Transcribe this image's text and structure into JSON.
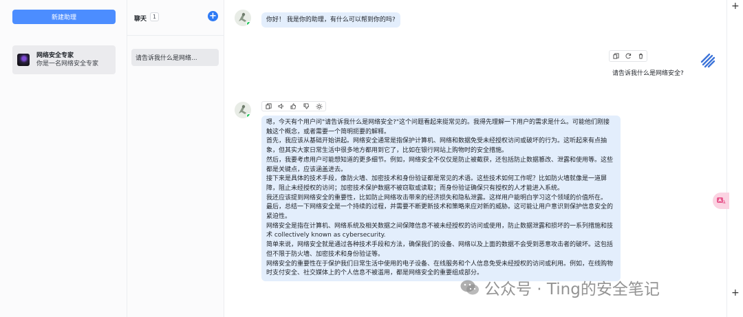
{
  "sidebar": {
    "new_assistant_label": "新建助理",
    "assistant": {
      "name": "网络安全专家",
      "description": "你是一名网络安全专家"
    }
  },
  "chats": {
    "title": "聊天",
    "count": "1",
    "items": [
      {
        "label": "请告诉我什么是网络..."
      }
    ]
  },
  "conversation": {
    "greeting": "你好！ 我是你的助理，有什么可以帮到你的吗?",
    "user_message": "请告诉我什么是网络安全?",
    "answer_paragraphs": [
      "嗯，今天有个用户问\"请告诉我什么是网络安全?\"这个问题看起来挺常见的。我得先理解一下用户的需求是什么。可能他们刚接触这个概念，或者需要一个简明扼要的解释。",
      "首先，我应该从基础开始讲起。网络安全通常是指保护计算机、网络和数据免受未经授权访问或破坏的行为。这听起来有点抽象，但其实大家日常生活中很多地方都用到它了，比如在银行网站上购物时的安全措施。",
      "然后，我要考虑用户可能想知道的更多细节。例如，网络安全不仅仅是防止被截获，还包括防止数据篡改、泄露和使用等。这些都是关键点，应该涵盖进去。",
      "接下来是具体的技术手段，像防火墙、加密技术和身份验证都是常见的术语。这些技术如何工作呢？比如防火墙就像是一道屏障，阻止未经授权的访问；加密技术保护数据不被窃取或读取；而身份验证确保只有授权的人才能进入系统。",
      "我还应该提到网络安全的重要性，比如防止网络攻击带来的经济损失和隐私泄露。这样用户能明白学习这个领域的价值所在。",
      "最后，总结一下网络安全是一个持续的过程，并需要不断更新技术和策略来应对新的威胁。这可能让用户意识到保护信息安全的紧迫性。",
      "网络安全是指在计算机、网络系统及相关数据之间保障信息不被未经授权的访问或使用，防止数据泄露和损坏的一系列措施和技术 collectively known as cybersecurity.",
      "简单来说，网络安全就是通过各种技术手段和方法，确保我们的设备、网络以及上面的数据不会受到恶意攻击者的破坏。这包括但不限于防火墙、加密技术和身份验证等。",
      "网络安全的重要性在于保护我们日常生活中使用的电子设备、在线服务和个人信息免受未经授权的访问或利用。例如，在线购物时支付安全、社交媒体上的个人信息不被滥用，都是网络安全的重要组成部分。"
    ]
  },
  "watermark": {
    "text": "公众号 · Ting的安全笔记"
  },
  "colors": {
    "accent": "#4c8dff",
    "bot_bubble": "#e3eefc",
    "online": "#22c55e"
  }
}
